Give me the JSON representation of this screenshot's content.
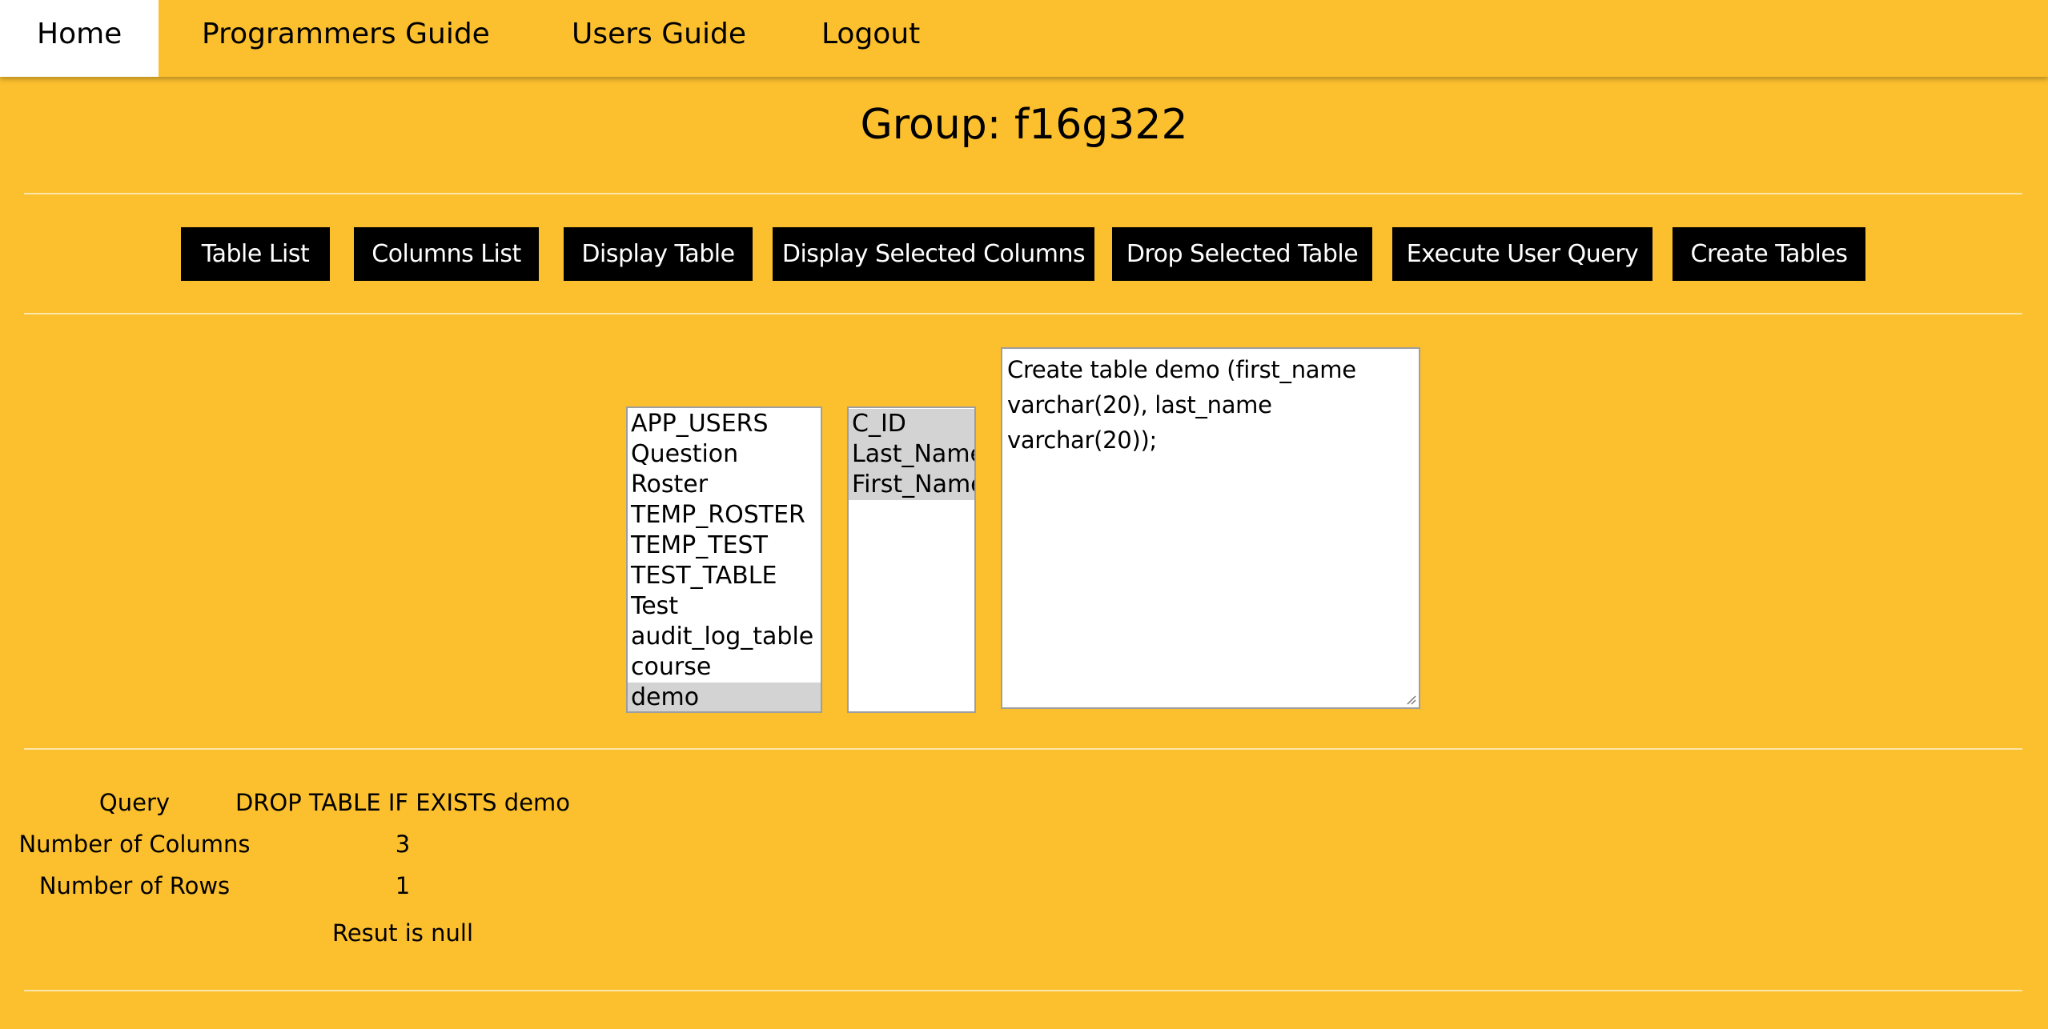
{
  "nav": {
    "home": "Home",
    "programmers_guide": "Programmers Guide",
    "users_guide": "Users Guide",
    "logout": "Logout"
  },
  "page": {
    "title": "Group: f16g322"
  },
  "toolbar": {
    "table_list": "Table List",
    "columns_list": "Columns List",
    "display_table": "Display Table",
    "display_selected_columns": "Display Selected Columns",
    "drop_selected_table": "Drop Selected Table",
    "execute_user_query": "Execute User Query",
    "create_tables": "Create Tables"
  },
  "tables_list": {
    "items": [
      "APP_USERS",
      "Question",
      "Roster",
      "TEMP_ROSTER",
      "TEMP_TEST",
      "TEST_TABLE",
      "Test",
      "audit_log_table",
      "course",
      "demo"
    ],
    "selected": "demo"
  },
  "columns_list": {
    "items": [
      "C_ID",
      "Last_Name",
      "First_Name"
    ],
    "selected": [
      "C_ID",
      "Last_Name",
      "First_Name"
    ]
  },
  "query_input": {
    "value": "Create table demo (first_name varchar(20), last_name varchar(20));"
  },
  "results": {
    "query_label": "Query",
    "query_value": "DROP TABLE IF EXISTS demo",
    "columns_label": "Number of Columns",
    "columns_value": "3",
    "rows_label": "Number of Rows",
    "rows_value": "1",
    "message": "Resut is null"
  },
  "colors": {
    "background": "#fcc02e",
    "button": "#000000",
    "selected_option": "#d3d3d3"
  }
}
